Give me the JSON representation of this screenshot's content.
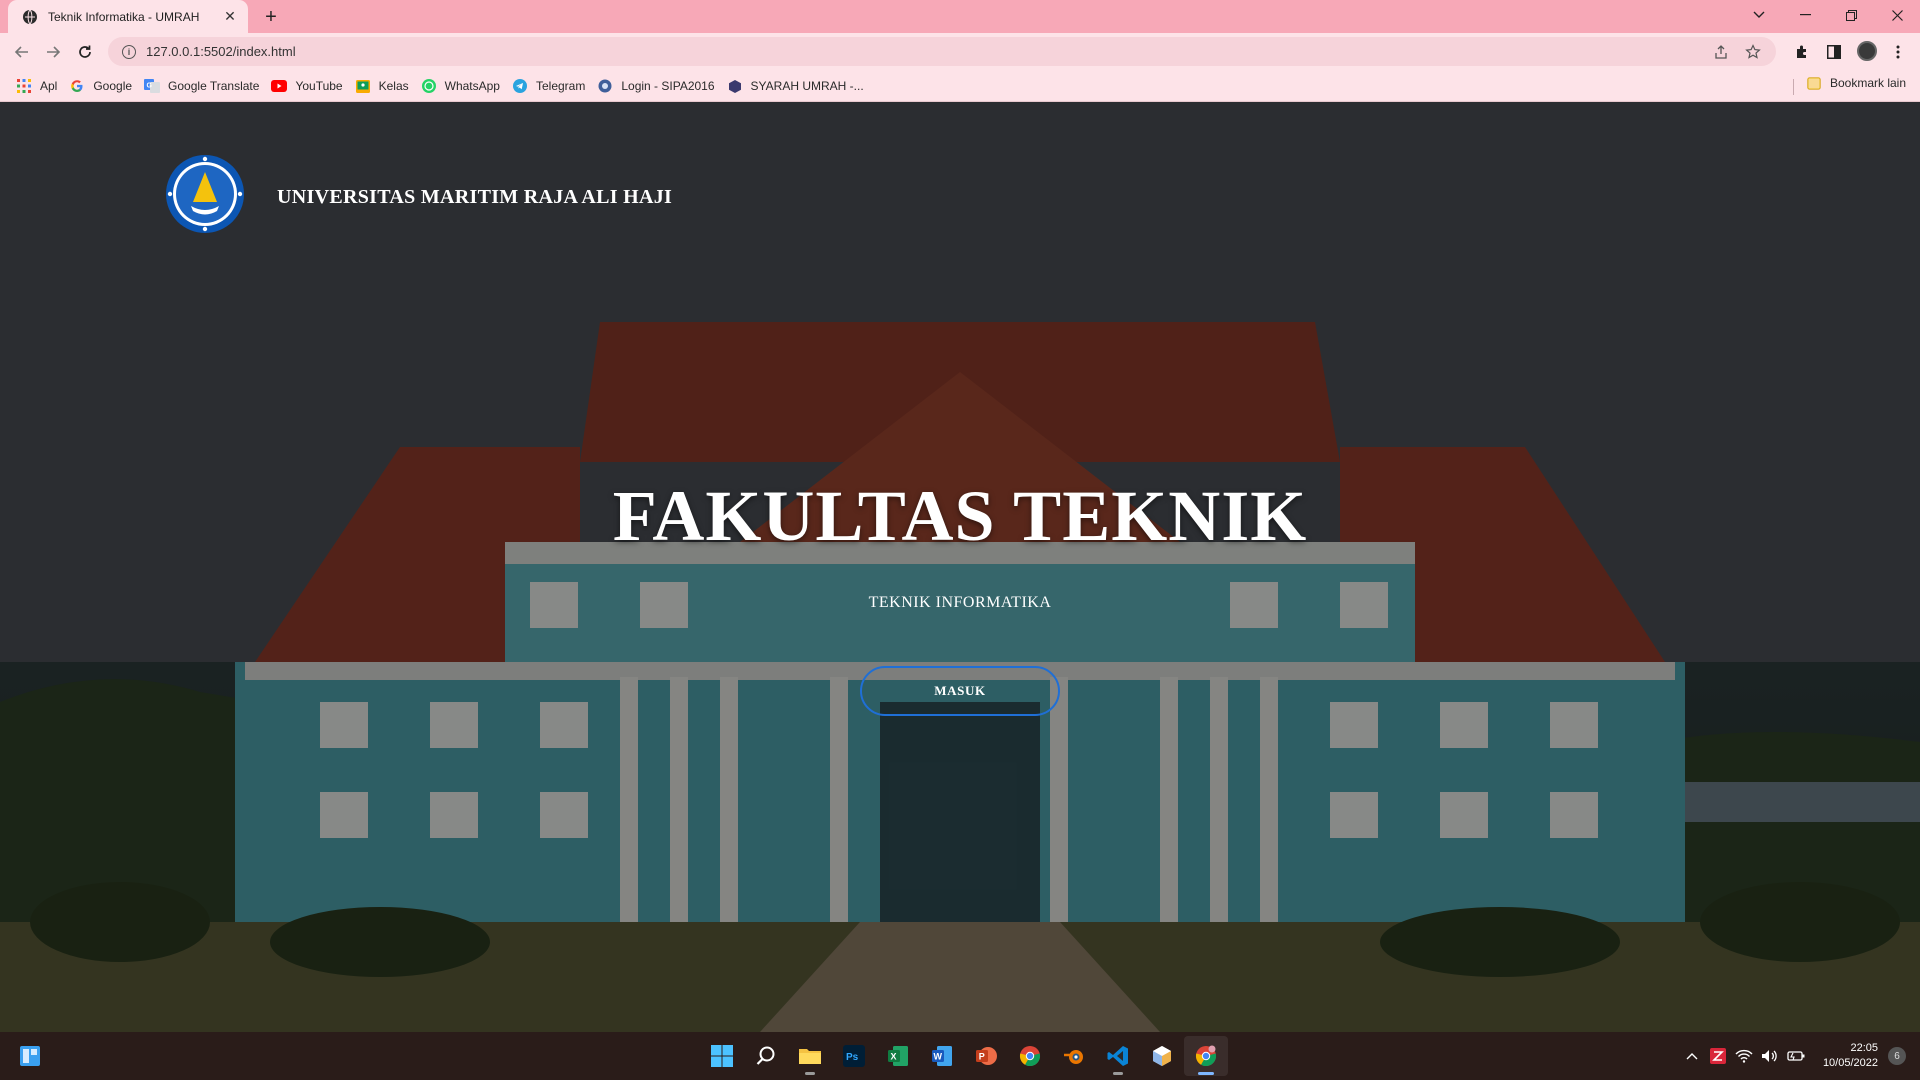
{
  "browser": {
    "tab_title": "Teknik Informatika - UMRAH",
    "new_tab_symbol": "+",
    "url": "127.0.0.1:5502/index.html",
    "accent_color": "#f7a8b7",
    "bookmarks": [
      {
        "label": "Apl",
        "icon": "apps-grid-icon"
      },
      {
        "label": "Google",
        "icon": "google-icon"
      },
      {
        "label": "Google Translate",
        "icon": "google-translate-icon"
      },
      {
        "label": "YouTube",
        "icon": "youtube-icon"
      },
      {
        "label": "Kelas",
        "icon": "classroom-icon"
      },
      {
        "label": "WhatsApp",
        "icon": "whatsapp-icon"
      },
      {
        "label": "Telegram",
        "icon": "telegram-icon"
      },
      {
        "label": "Login - SIPA2016",
        "icon": "sipa-icon"
      },
      {
        "label": "SYARAH UMRAH -...",
        "icon": "syarah-icon"
      }
    ],
    "other_bookmarks": "Bookmark lain"
  },
  "page": {
    "site_name": "UNIVERSITAS MARITIM RAJA ALI HAJI",
    "hero_title": "FAKULTAS TEKNIK",
    "hero_subtitle": "TEKNIK INFORMATIKA",
    "cta_label": "MASUK",
    "cta_border_color": "#1f6fd6"
  },
  "taskbar": {
    "time": "22:05",
    "date": "10/05/2022",
    "notification_count": "6",
    "apps": [
      "windows-start-icon",
      "search-icon",
      "file-explorer-icon",
      "photoshop-icon",
      "excel-icon",
      "word-icon",
      "powerpoint-icon",
      "chrome-icon",
      "blender-icon",
      "vscode-icon",
      "cube-app-icon",
      "chrome-profile-icon"
    ]
  }
}
